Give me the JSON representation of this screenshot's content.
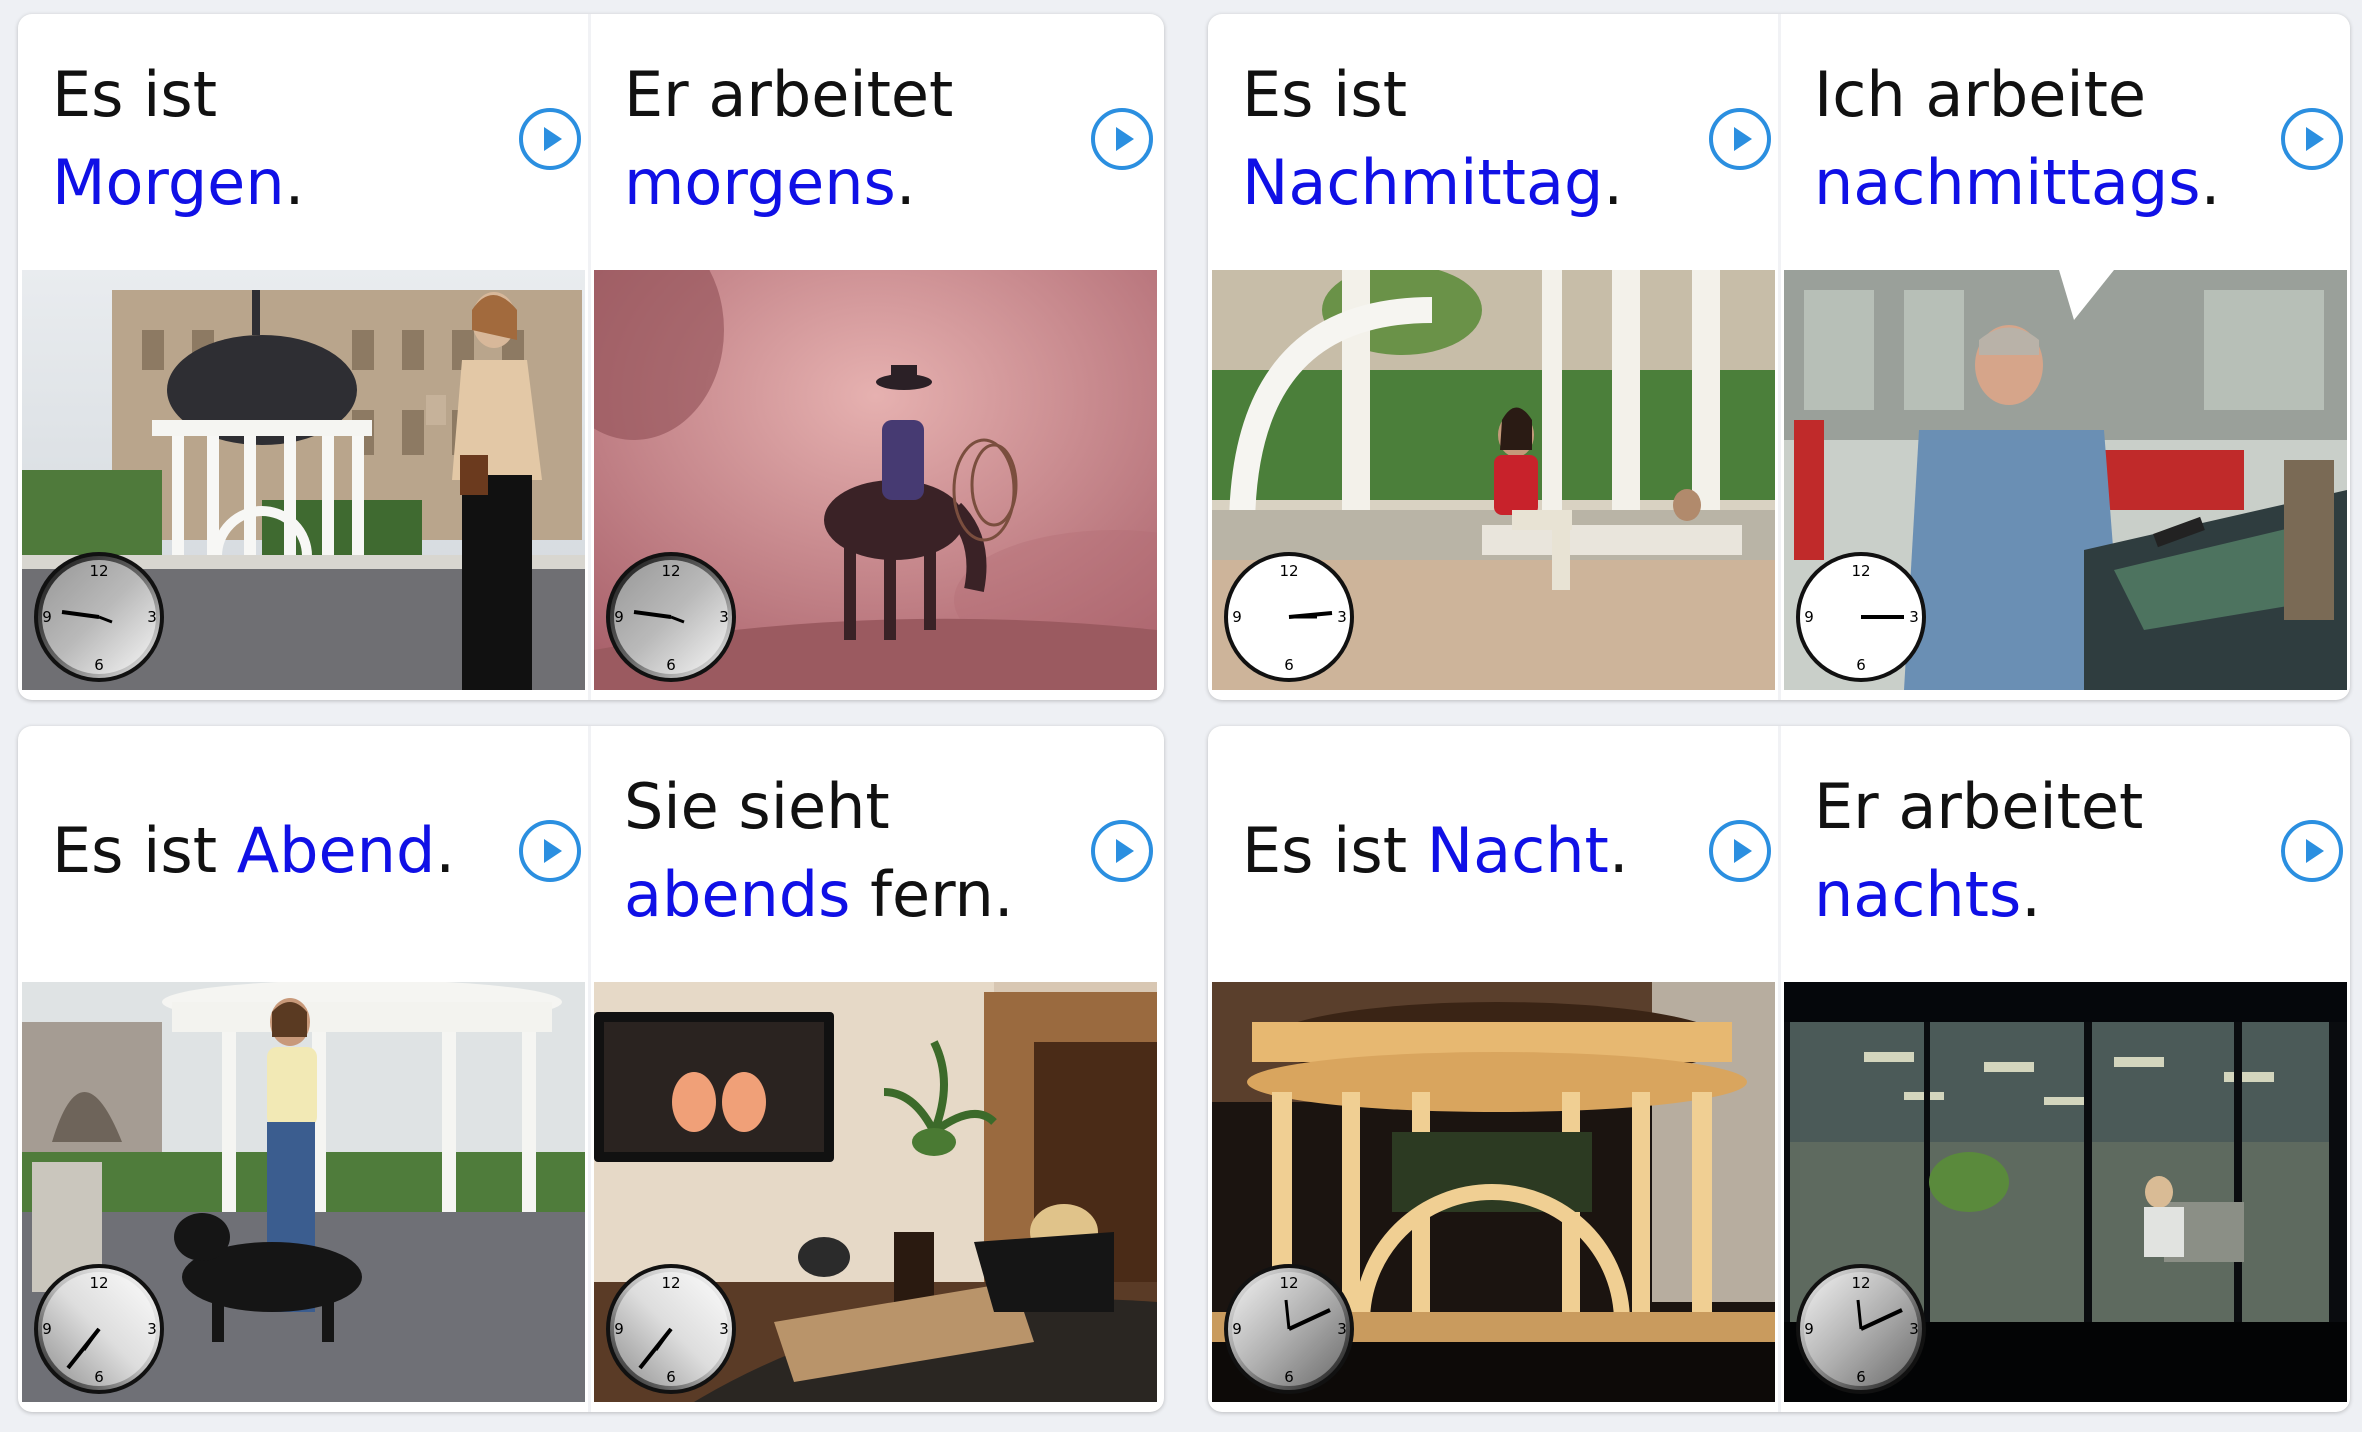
{
  "cards": [
    {
      "left": {
        "lines": [
          [
            "Es ist",
            ""
          ],
          [
            "",
            "Morgen"
          ],
          [
            ".",
            ""
          ]
        ],
        "clock_hour_marks": [
          "12",
          "3",
          "6",
          "9"
        ],
        "scene": "morning-gazebo-woman-walking"
      },
      "right": {
        "scene": "morning-cowboy-horse-lasso"
      }
    }
  ],
  "tiles": {
    "t1": {
      "pre": "Es ist",
      "kw": "Morgen",
      "post": ".",
      "layout": "two",
      "play": "play-audio-icon"
    },
    "t2": {
      "pre": "Er arbeitet",
      "kw": "morgens",
      "post": ".",
      "layout": "two",
      "play": "play-audio-icon"
    },
    "t3": {
      "pre": "Es ist",
      "kw": "Nachmittag",
      "post": ".",
      "layout": "two",
      "play": "play-audio-icon"
    },
    "t4": {
      "pre": "Ich arbeite",
      "kw": "nachmittags",
      "post": ".",
      "layout": "two",
      "play": "play-audio-icon"
    },
    "t5": {
      "pre": "Es ist ",
      "kw": "Abend",
      "post": ".",
      "layout": "one",
      "play": "play-audio-icon"
    },
    "t6": {
      "pre": "Sie sieht",
      "kw": "abends",
      "post": " fern.",
      "layout": "two",
      "play": "play-audio-icon"
    },
    "t7": {
      "pre": "Es ist ",
      "kw": "Nacht",
      "post": ".",
      "layout": "one",
      "play": "play-audio-icon"
    },
    "t8": {
      "pre": "Er arbeitet",
      "kw": "nachts",
      "post": ".",
      "layout": "two",
      "play": "play-audio-icon"
    }
  },
  "clock": {
    "n12": "12",
    "n3": "3",
    "n6": "6",
    "n9": "9"
  },
  "colors": {
    "keyword": "#1010e6",
    "text": "#111111",
    "play": "#2b8fe0",
    "background": "#eef0f4"
  }
}
